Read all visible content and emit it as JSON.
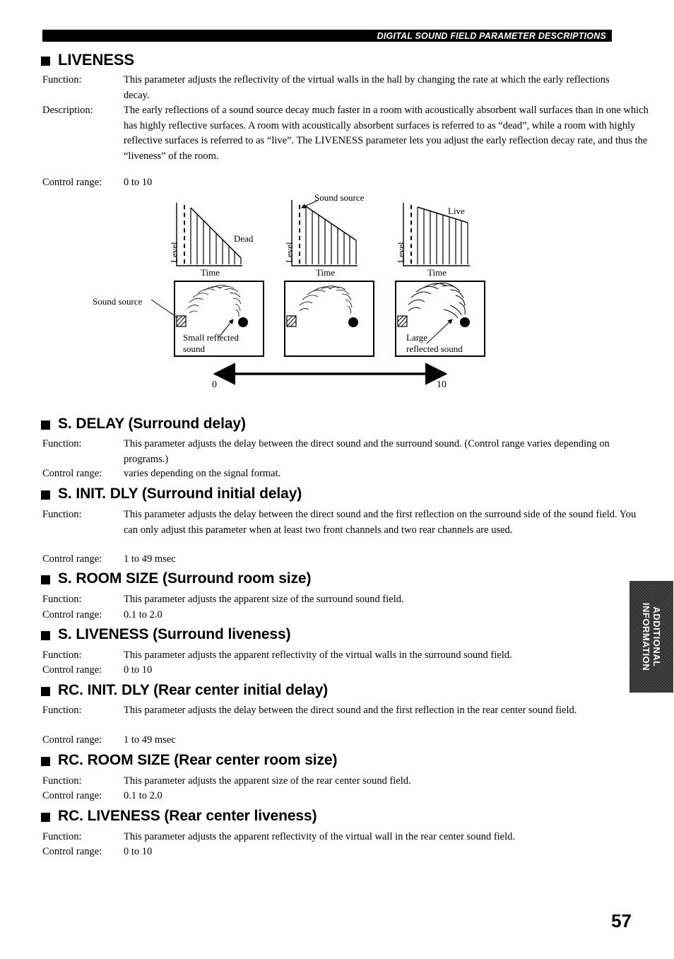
{
  "header": {
    "running_title": "DIGITAL SOUND FIELD PARAMETER DESCRIPTIONS"
  },
  "labels": {
    "function": "Function:",
    "description": "Description:",
    "control_range": "Control range:"
  },
  "sections": [
    {
      "id": "liveness",
      "title": "LIVENESS",
      "function": "This parameter adjusts the reflectivity of the virtual walls in the hall by changing the rate at which the early reflections decay.",
      "description": "The early reflections of a sound source decay much faster in a room with acoustically absorbent wall surfaces than in one which has highly reflective surfaces. A room with acoustically absorbent surfaces is referred to as “dead”, while a room with highly reflective surfaces is referred to as “live”. The LIVENESS parameter lets you adjust the early reflection decay rate, and thus the “liveness” of the room.",
      "control_range": "0 to 10"
    },
    {
      "id": "s-delay",
      "title": "S. DELAY (Surround delay)",
      "function": "This parameter adjusts the delay between the direct sound and the surround sound. (Control range varies depending on programs.)",
      "control_range": "varies depending on the signal format."
    },
    {
      "id": "s-init-dly",
      "title": "S. INIT. DLY (Surround initial delay)",
      "function": "This parameter adjusts the delay between the direct sound and the first reflection on the surround side of the sound field. You can only adjust this parameter when at least two front channels and two rear channels are used.",
      "control_range": "1 to 49 msec"
    },
    {
      "id": "s-room-size",
      "title": "S. ROOM SIZE (Surround room size)",
      "function": "This parameter adjusts the apparent size of the surround sound field.",
      "control_range": "0.1 to 2.0"
    },
    {
      "id": "s-liveness",
      "title": "S. LIVENESS (Surround liveness)",
      "function": "This parameter adjusts the apparent reflectivity of the virtual walls in the surround sound field.",
      "control_range": "0 to 10"
    },
    {
      "id": "rc-init-dly",
      "title": "RC. INIT. DLY (Rear center initial delay)",
      "function": "This parameter adjusts the delay between the direct sound and the first reflection in the rear center sound field.",
      "control_range": "1 to 49 msec"
    },
    {
      "id": "rc-room-size",
      "title": "RC. ROOM SIZE (Rear center room size)",
      "function": "This parameter adjusts the apparent size of the rear center sound field.",
      "control_range": "0.1 to 2.0"
    },
    {
      "id": "rc-liveness",
      "title": "RC. LIVENESS (Rear center liveness)",
      "function": "This parameter adjusts the apparent reflectivity of the virtual wall in the rear center sound field.",
      "control_range": "0 to 10"
    }
  ],
  "diagram": {
    "axis_level": "Level",
    "axis_time": "Time",
    "graph1_label": "Dead",
    "graph2_label": "Sound source",
    "graph3_label": "Live",
    "room_source_label": "Sound source",
    "room1_label_line1": "Small reflected",
    "room1_label_line2": "sound",
    "room3_label_line1": "Large",
    "room3_label_line2": "reflected sound",
    "scale_min": "0",
    "scale_max": "10"
  },
  "side_tab": {
    "line1": "ADDITIONAL",
    "line2": "INFORMATION"
  },
  "footer": {
    "page_number": "57"
  }
}
